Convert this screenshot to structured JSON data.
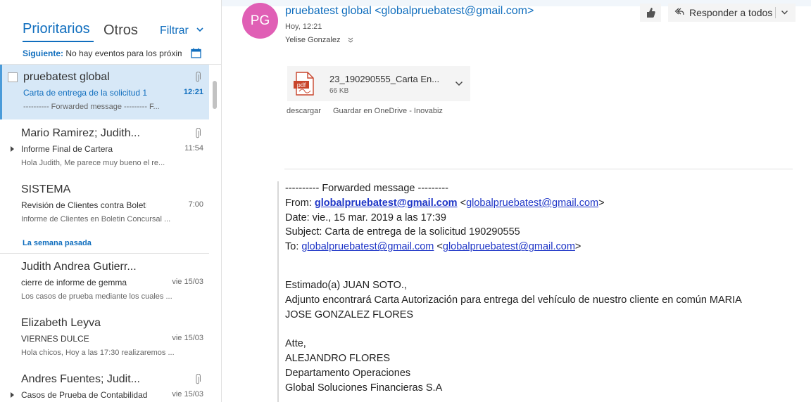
{
  "folder_tabs": {
    "focused": "Prioritarios",
    "other": "Otros",
    "filter": "Filtrar"
  },
  "next_event": {
    "label": "Siguiente:",
    "text": "No hay eventos para los próxim"
  },
  "messages": [
    {
      "sender": "pruebatest global",
      "subject": "Carta de entrega de la solicitud 1",
      "time": "12:21",
      "preview": "---------- Forwarded message --------- F...",
      "attachment": true,
      "selected": true
    },
    {
      "sender": "Mario Ramirez; Judith...",
      "subject": "Informe Final de Cartera",
      "time": "11:54",
      "preview": "Hola Judith,  Me parece muy bueno el re...",
      "attachment": true,
      "thread": true
    },
    {
      "sender": "SISTEMA",
      "subject": "Revisión de Clientes contra Boletí",
      "time": "7:00",
      "preview": "Informe de Clientes en Boletin Concursal ..."
    }
  ],
  "section_last_week": "La semana pasada",
  "messages_last_week": [
    {
      "sender": "Judith Andrea Gutierr...",
      "subject": "cierre de informe de gemma",
      "time": "vie 15/03",
      "preview": "Los casos de prueba mediante los cuales ..."
    },
    {
      "sender": "Elizabeth Leyva",
      "subject": "VIERNES DULCE",
      "time": "vie 15/03",
      "preview": "Hola chicos, Hoy a las 17:30 realizaremos ..."
    },
    {
      "sender": "Andres Fuentes; Judit...",
      "subject": "Casos de Prueba de Contabilidad",
      "time": "vie 15/03",
      "attachment": true,
      "thread": true
    }
  ],
  "reading": {
    "avatar_initials": "PG",
    "from": "pruebatest global <globalpruebatest@gmail.com>",
    "date": "Hoy, 12:21",
    "to": "Yelise Gonzalez",
    "reply_all": "Responder a todos",
    "attachment": {
      "name": "23_190290555_Carta En...",
      "size": "66 KB",
      "download": "descargar",
      "save_onedrive": "Guardar en OneDrive - Inovabiz"
    },
    "body": {
      "fwd_header": "---------- Forwarded message ---------",
      "from_label": "From: ",
      "from_name": "globalpruebatest@gmail.com",
      "from_lt": " <",
      "from_addr": "globalpruebatest@gmail.com",
      "from_gt": ">",
      "date_line": "Date: vie., 15 mar. 2019 a las 17:39",
      "subject_line": "Subject: Carta de entrega de la solicitud 190290555",
      "to_label": "To: ",
      "to_name": "globalpruebatest@gmail.com",
      "to_lt": " <",
      "to_addr": "globalpruebatest@gmail.com",
      "to_gt": ">",
      "greeting": "Estimado(a) JUAN SOTO.,",
      "p1_line1": "Adjunto encontrará Carta Autorización para entrega del vehículo de nuestro cliente en común MARIA",
      "p1_line2": "JOSE GONZALEZ FLORES",
      "sig1": "Atte,",
      "sig2": "ALEJANDRO FLORES",
      "sig3": "Departamento Operaciones",
      "sig4": "Global Soluciones Financieras S.A"
    }
  },
  "colors": {
    "accent": "#106ebe",
    "avatar": "#e05fb5",
    "selected_bg": "#d7e8f7"
  }
}
